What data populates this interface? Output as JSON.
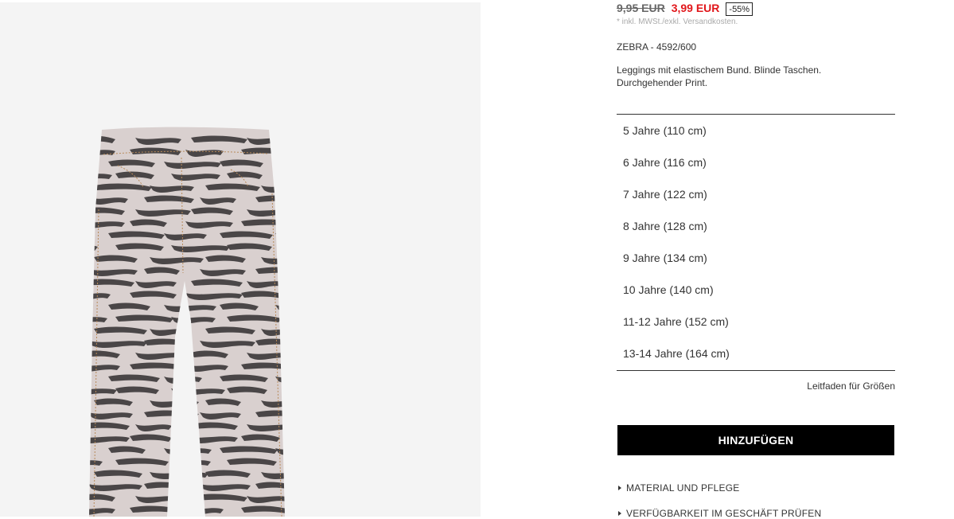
{
  "product": {
    "old_price": "9,95 EUR",
    "new_price": "3,99 EUR",
    "discount": "-55%",
    "tax_note": "* inkl. MWSt./exkl. Versandkosten.",
    "reference": "ZEBRA - 4592/600",
    "description": "Leggings mit elastischem Bund. Blinde Taschen. Durchgehender Print."
  },
  "sizes": [
    "5 Jahre (110 cm)",
    "6 Jahre (116 cm)",
    "7 Jahre (122 cm)",
    "8 Jahre (128 cm)",
    "9 Jahre (134 cm)",
    "10 Jahre (140 cm)",
    "11-12 Jahre (152 cm)",
    "13-14 Jahre (164 cm)"
  ],
  "size_guide_label": "Leitfaden für Größen",
  "add_button_label": "HINZUFÜGEN",
  "accordion": {
    "material": "MATERIAL UND PFLEGE",
    "availability": "VERFÜGBARKEIT IM GESCHÄFT PRÜFEN"
  },
  "colors": {
    "sale_price": "#e1161a",
    "button_bg": "#000000",
    "image_bg": "#f4f4f4",
    "leggings_base": "#d9d0cf",
    "zebra_stripe": "#4a4647"
  }
}
